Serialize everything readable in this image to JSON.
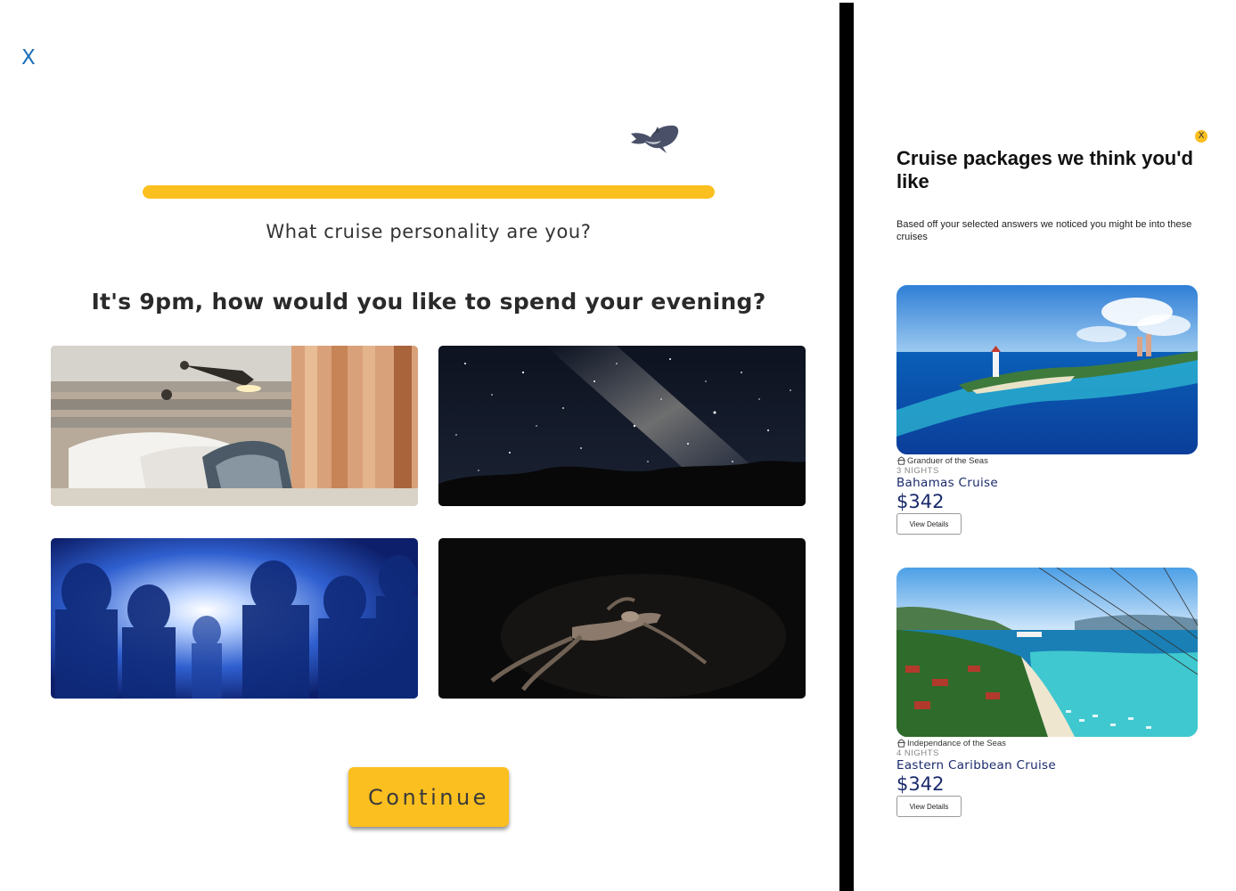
{
  "quiz": {
    "close_label": "X",
    "progress_percent": 100,
    "title": "What cruise personality are you?",
    "question": "It's 9pm, how would you like to spend your evening?",
    "options": [
      {
        "id": "relax",
        "image": "cozy-bed-photo"
      },
      {
        "id": "stars",
        "image": "milky-way-night-sky-photo"
      },
      {
        "id": "party",
        "image": "concert-crowd-photo"
      },
      {
        "id": "float",
        "image": "night-swim-photo"
      }
    ],
    "continue_label": "Continue",
    "accent_color": "#fbbf1f"
  },
  "recommendations": {
    "close_label": "X",
    "title": "Cruise packages we think you'd like",
    "subtitle": "Based off your selected answers we noticed you might be into these cruises",
    "cards": [
      {
        "ship": "Granduer of the Seas",
        "nights": "3 NIGHTS",
        "name": "Bahamas Cruise",
        "price": "$342",
        "button": "View Details",
        "image": "bahamas-lighthouse-island-photo"
      },
      {
        "ship": "Independance of the Seas",
        "nights": "4 NIGHTS",
        "name": "Eastern Caribbean Cruise",
        "price": "$342",
        "button": "View Details",
        "image": "caribbean-zipline-beach-photo"
      }
    ]
  }
}
